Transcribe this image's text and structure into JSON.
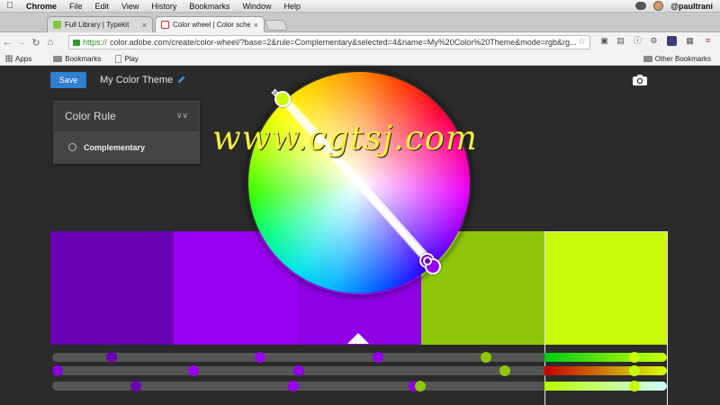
{
  "menubar": {
    "app": "Chrome",
    "items": [
      "File",
      "Edit",
      "View",
      "History",
      "Bookmarks",
      "Window",
      "Help"
    ],
    "user": "@paultrani"
  },
  "tabs": [
    {
      "title": "Full Library | Typekit",
      "close": "×",
      "active": false
    },
    {
      "title": "Color wheel | Color schem",
      "close": "×",
      "active": true
    }
  ],
  "toolbar": {
    "url_scheme": "https://",
    "url_rest": "color.adobe.com/create/color-wheel/?base=2&rule=Complementary&selected=4&name=My%20Color%20Theme&mode=rgb&rg..."
  },
  "bookmarks": {
    "apps": "Apps",
    "bookmarks": "Bookmarks",
    "play": "Play",
    "other": "Other Bookmarks"
  },
  "app": {
    "save_label": "Save",
    "theme_name": "My Color Theme"
  },
  "color_rule": {
    "header": "Color Rule",
    "selected_rule": "Complementary"
  },
  "theme": {
    "selected_index": 4,
    "base_index": 2,
    "colors": [
      "#6a00b4",
      "#9a00f0",
      "#8f00e6",
      "#8ec70a",
      "#c8fa0a"
    ]
  },
  "sliders": {
    "fills": [
      "linear-gradient(90deg,#00cc14,#ccff00)",
      "linear-gradient(90deg,#c80000,#d4ff00)",
      "linear-gradient(90deg,#b7ff00,#d0ffff)"
    ],
    "track_color": "#555555",
    "knobs": [
      [
        {
          "v": 0.09,
          "c": "#6a00b4"
        },
        {
          "v": 0.335,
          "c": "#9a00f0"
        },
        {
          "v": 0.53,
          "c": "#8f00e6"
        },
        {
          "v": 0.71,
          "c": "#8ec70a"
        },
        {
          "v": 0.955,
          "c": "#c8fa0a"
        }
      ],
      [
        {
          "v": 0.0,
          "c": "#8a00d8"
        },
        {
          "v": 0.225,
          "c": "#9a00f0"
        },
        {
          "v": 0.4,
          "c": "#8f00e6"
        },
        {
          "v": 0.74,
          "c": "#8ec70a"
        },
        {
          "v": 0.955,
          "c": "#c8fa0a"
        }
      ],
      [
        {
          "v": 0.13,
          "c": "#6a00b4"
        },
        {
          "v": 0.39,
          "c": "#9a00f0"
        },
        {
          "v": 0.59,
          "c": "#8f00e6"
        },
        {
          "v": 0.6,
          "c": "#8ec70a"
        },
        {
          "v": 0.955,
          "c": "#c8fa0a"
        }
      ]
    ]
  },
  "watermark": "www.cgtsj.com",
  "icons": {
    "edit": "pencil-icon",
    "capture": "camera-icon",
    "rule_toggle": "chevron-down-icon"
  }
}
